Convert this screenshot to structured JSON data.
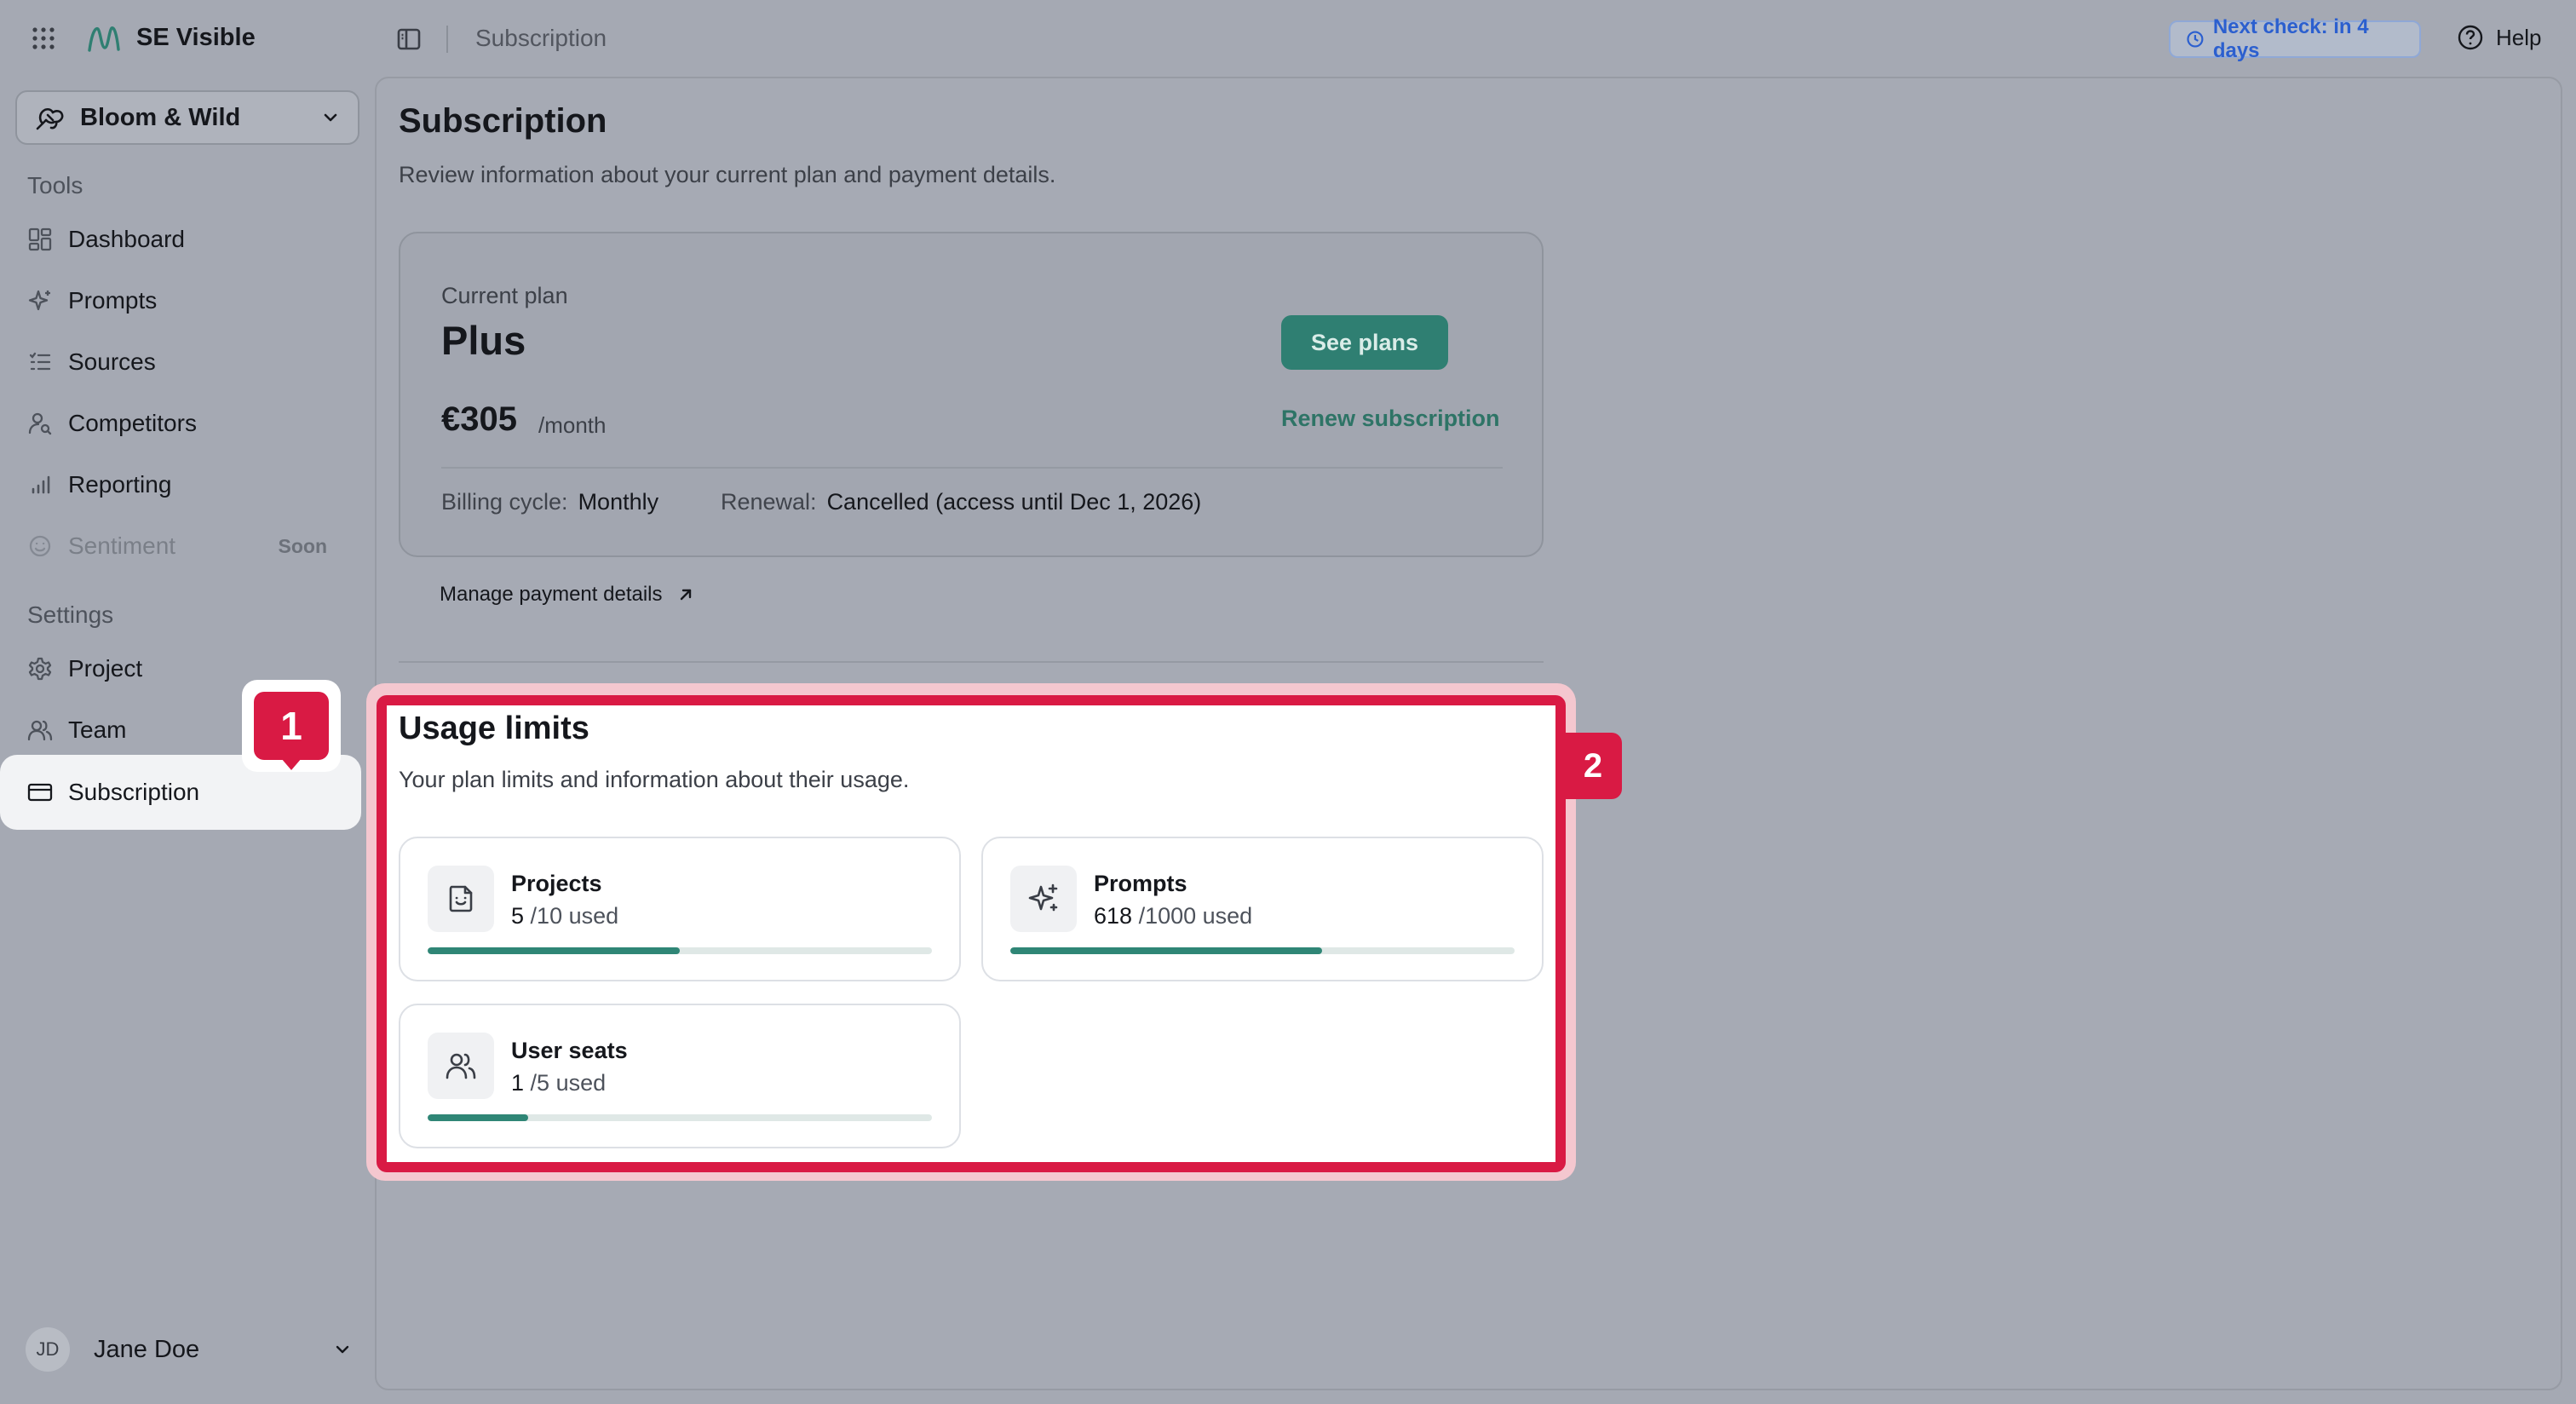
{
  "app": {
    "name": "SE Visible",
    "breadcrumb": "Subscription",
    "next_check": "Next check: in 4 days",
    "help_label": "Help"
  },
  "sidebar": {
    "project": "Bloom & Wild",
    "tools_label": "Tools",
    "tools": [
      {
        "label": "Dashboard",
        "icon": "dashboard-icon"
      },
      {
        "label": "Prompts",
        "icon": "sparkle-icon"
      },
      {
        "label": "Sources",
        "icon": "list-icon"
      },
      {
        "label": "Competitors",
        "icon": "user-search-icon"
      },
      {
        "label": "Reporting",
        "icon": "bar-chart-icon"
      },
      {
        "label": "Sentiment",
        "icon": "smile-icon",
        "badge": "Soon",
        "disabled": true
      }
    ],
    "settings_label": "Settings",
    "settings": [
      {
        "label": "Project",
        "icon": "gear-icon"
      },
      {
        "label": "Team",
        "icon": "users-icon"
      },
      {
        "label": "Subscription",
        "icon": "credit-card-icon",
        "active": true
      }
    ],
    "user": {
      "initials": "JD",
      "name": "Jane Doe"
    }
  },
  "page": {
    "title": "Subscription",
    "subtitle": "Review information about your current plan and payment details."
  },
  "plan": {
    "label": "Current plan",
    "name": "Plus",
    "price": "€305",
    "period": "/month",
    "see_plans": "See plans",
    "renew": "Renew subscription",
    "billing_key": "Billing cycle:",
    "billing_value": "Monthly",
    "renewal_key": "Renewal:",
    "renewal_value": "Cancelled (access until Dec 1, 2026)"
  },
  "manage_payment": "Manage payment details",
  "usage": {
    "title": "Usage limits",
    "subtitle": "Your plan limits and information about their usage.",
    "items": [
      {
        "label": "Projects",
        "used": "5",
        "limit": "/10 used",
        "fraction": 0.5,
        "icon": "smile-file-icon"
      },
      {
        "label": "Prompts",
        "used": "618",
        "limit": "/1000 used",
        "fraction": 0.618,
        "icon": "sparkle-icon"
      },
      {
        "label": "User seats",
        "used": "1",
        "limit": "/5 used",
        "fraction": 0.2,
        "icon": "users-icon"
      }
    ]
  },
  "annotations": {
    "badge_1": "1",
    "badge_2": "2"
  },
  "colors": {
    "accent": "#2f8676",
    "highlight": "#d91a44",
    "link": "#2b5fcf"
  }
}
